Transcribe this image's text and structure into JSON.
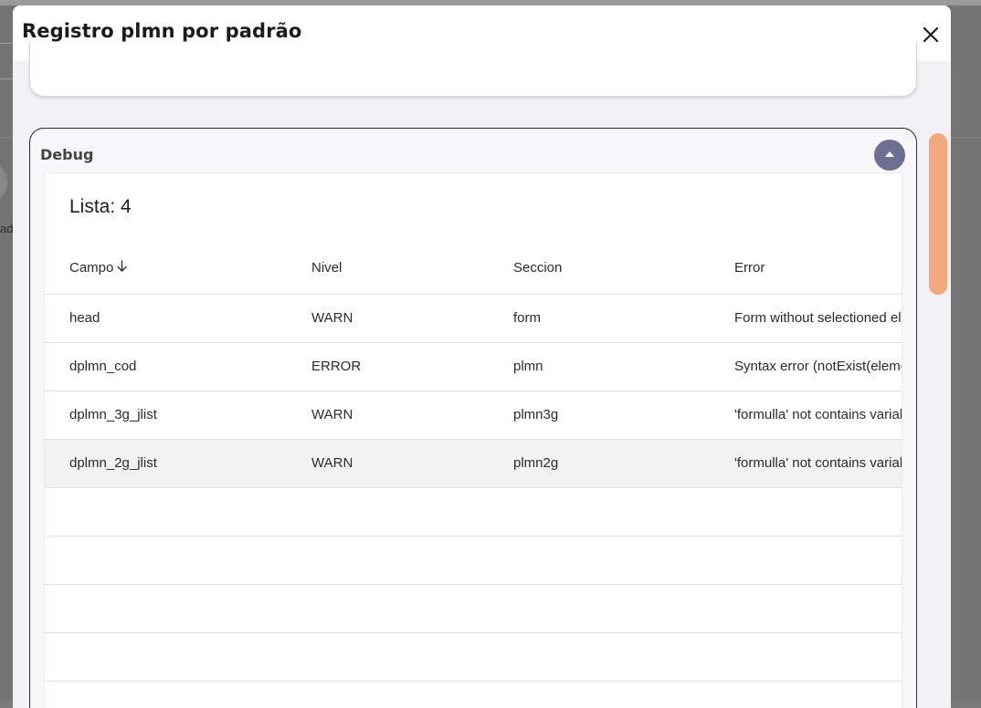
{
  "background": {
    "partial_text": "ad"
  },
  "modal": {
    "title": "Registro plmn por padrão",
    "close_icon": "close-icon"
  },
  "debug": {
    "title": "Debug",
    "collapse_icon": "caret-up-icon",
    "list_label": "Lista:",
    "list_count": "4",
    "columns": [
      {
        "label": "Campo",
        "sort": "descending-arrow-icon"
      },
      {
        "label": "Nivel"
      },
      {
        "label": "Seccion"
      },
      {
        "label": "Error"
      }
    ],
    "rows": [
      {
        "campo": "head",
        "nivel": "WARN",
        "seccion": "form",
        "error": "Form without selectioned elements"
      },
      {
        "campo": "dplmn_cod",
        "nivel": "ERROR",
        "seccion": "plmn",
        "error": "Syntax error (notExist(element))"
      },
      {
        "campo": "dplmn_3g_jlist",
        "nivel": "WARN",
        "seccion": "plmn3g",
        "error": "'formulla' not contains variables"
      },
      {
        "campo": "dplmn_2g_jlist",
        "nivel": "WARN",
        "seccion": "plmn2g",
        "error": "'formulla' not contains variables"
      }
    ],
    "highlighted_row": 3
  },
  "colors": {
    "accent_button": "#6c6f93",
    "scrollbar_thumb": "#f2a87e",
    "card_border": "#2b2b2b"
  }
}
